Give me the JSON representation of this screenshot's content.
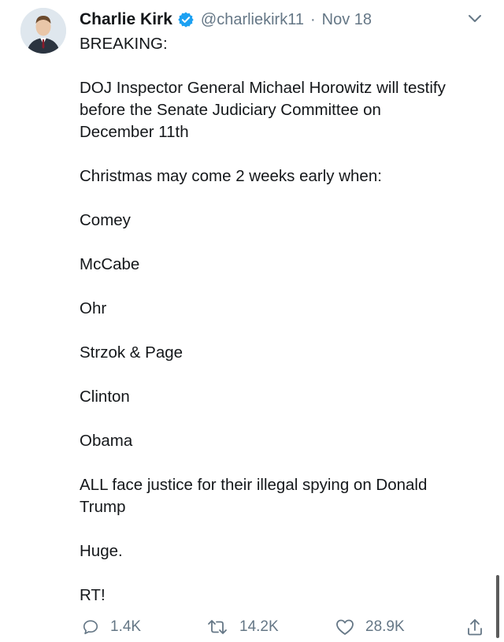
{
  "author": {
    "name": "Charlie Kirk",
    "handle": "@charliekirk11",
    "separator": "·",
    "date": "Nov 18",
    "verified": true
  },
  "tweet": {
    "lines": [
      "BREAKING:",
      "",
      "DOJ Inspector General Michael Horowitz will testify",
      "before the Senate Judiciary Committee on",
      "December 11th",
      "",
      "Christmas may come 2 weeks early when:",
      "",
      "Comey",
      "",
      "McCabe",
      "",
      "Ohr",
      "",
      "Strzok & Page",
      "",
      "Clinton",
      "",
      "Obama",
      "",
      "ALL face justice for their illegal spying on Donald",
      "Trump",
      "",
      "Huge.",
      "",
      "RT!"
    ]
  },
  "actions": {
    "replies": "1.4K",
    "retweets": "14.2K",
    "likes": "28.9K"
  },
  "icons": {
    "verified": "verified-badge-icon",
    "menu": "chevron-down-icon",
    "reply": "reply-icon",
    "retweet": "retweet-icon",
    "like": "heart-icon",
    "share": "share-icon"
  },
  "colors": {
    "text": "#14171a",
    "muted": "#657786",
    "verified": "#1da1f2"
  }
}
